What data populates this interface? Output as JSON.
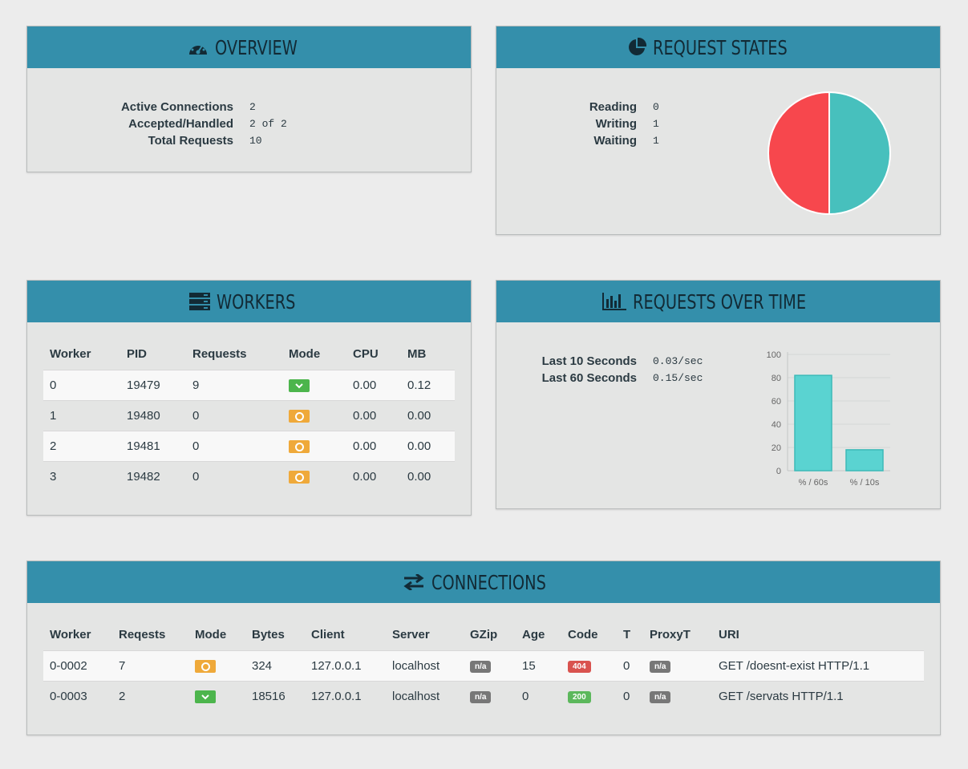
{
  "overview": {
    "title": "OVERVIEW",
    "rows": [
      {
        "label": "Active Connections",
        "value": "2"
      },
      {
        "label": "Accepted/Handled",
        "value": "2 of 2"
      },
      {
        "label": "Total Requests",
        "value": "10"
      }
    ]
  },
  "request_states": {
    "title": "REQUEST STATES",
    "rows": [
      {
        "label": "Reading",
        "value": "0"
      },
      {
        "label": "Writing",
        "value": "1"
      },
      {
        "label": "Waiting",
        "value": "1"
      }
    ],
    "colors": {
      "writing": "#f7474d",
      "waiting": "#47c0bd"
    }
  },
  "workers": {
    "title": "WORKERS",
    "headers": [
      "Worker",
      "PID",
      "Requests",
      "Mode",
      "CPU",
      "MB"
    ],
    "rows": [
      {
        "worker": "0",
        "pid": "19479",
        "requests": "9",
        "mode": "ok",
        "cpu": "0.00",
        "mb": "0.12"
      },
      {
        "worker": "1",
        "pid": "19480",
        "requests": "0",
        "mode": "wait",
        "cpu": "0.00",
        "mb": "0.00"
      },
      {
        "worker": "2",
        "pid": "19481",
        "requests": "0",
        "mode": "wait",
        "cpu": "0.00",
        "mb": "0.00"
      },
      {
        "worker": "3",
        "pid": "19482",
        "requests": "0",
        "mode": "wait",
        "cpu": "0.00",
        "mb": "0.00"
      }
    ]
  },
  "requests_over_time": {
    "title": "REQUESTS OVER TIME",
    "rows": [
      {
        "label": "Last 10 Seconds",
        "value": "0.03/sec"
      },
      {
        "label": "Last 60 Seconds",
        "value": "0.15/sec"
      }
    ],
    "chart_data": {
      "type": "bar",
      "categories": [
        "% / 60s",
        "% / 10s"
      ],
      "values": [
        82,
        18
      ],
      "ylim": [
        0,
        100
      ],
      "yticks": [
        "0",
        "20",
        "40",
        "60",
        "80",
        "100"
      ],
      "grid": true,
      "bar_color": "#5ad3d1"
    }
  },
  "connections": {
    "title": "CONNECTIONS",
    "headers": [
      "Worker",
      "Reqests",
      "Mode",
      "Bytes",
      "Client",
      "Server",
      "GZip",
      "Age",
      "Code",
      "T",
      "ProxyT",
      "URI"
    ],
    "rows": [
      {
        "worker": "0-0002",
        "reqs": "7",
        "mode": "wait",
        "bytes": "324",
        "client": "127.0.0.1",
        "server": "localhost",
        "gzip": "n/a",
        "age": "15",
        "code": "404",
        "code_color": "red",
        "t": "0",
        "proxyt": "n/a",
        "uri": "GET /doesnt-exist HTTP/1.1"
      },
      {
        "worker": "0-0003",
        "reqs": "2",
        "mode": "ok",
        "bytes": "18516",
        "client": "127.0.0.1",
        "server": "localhost",
        "gzip": "n/a",
        "age": "0",
        "code": "200",
        "code_color": "green",
        "t": "0",
        "proxyt": "n/a",
        "uri": "GET /servats HTTP/1.1"
      }
    ]
  }
}
